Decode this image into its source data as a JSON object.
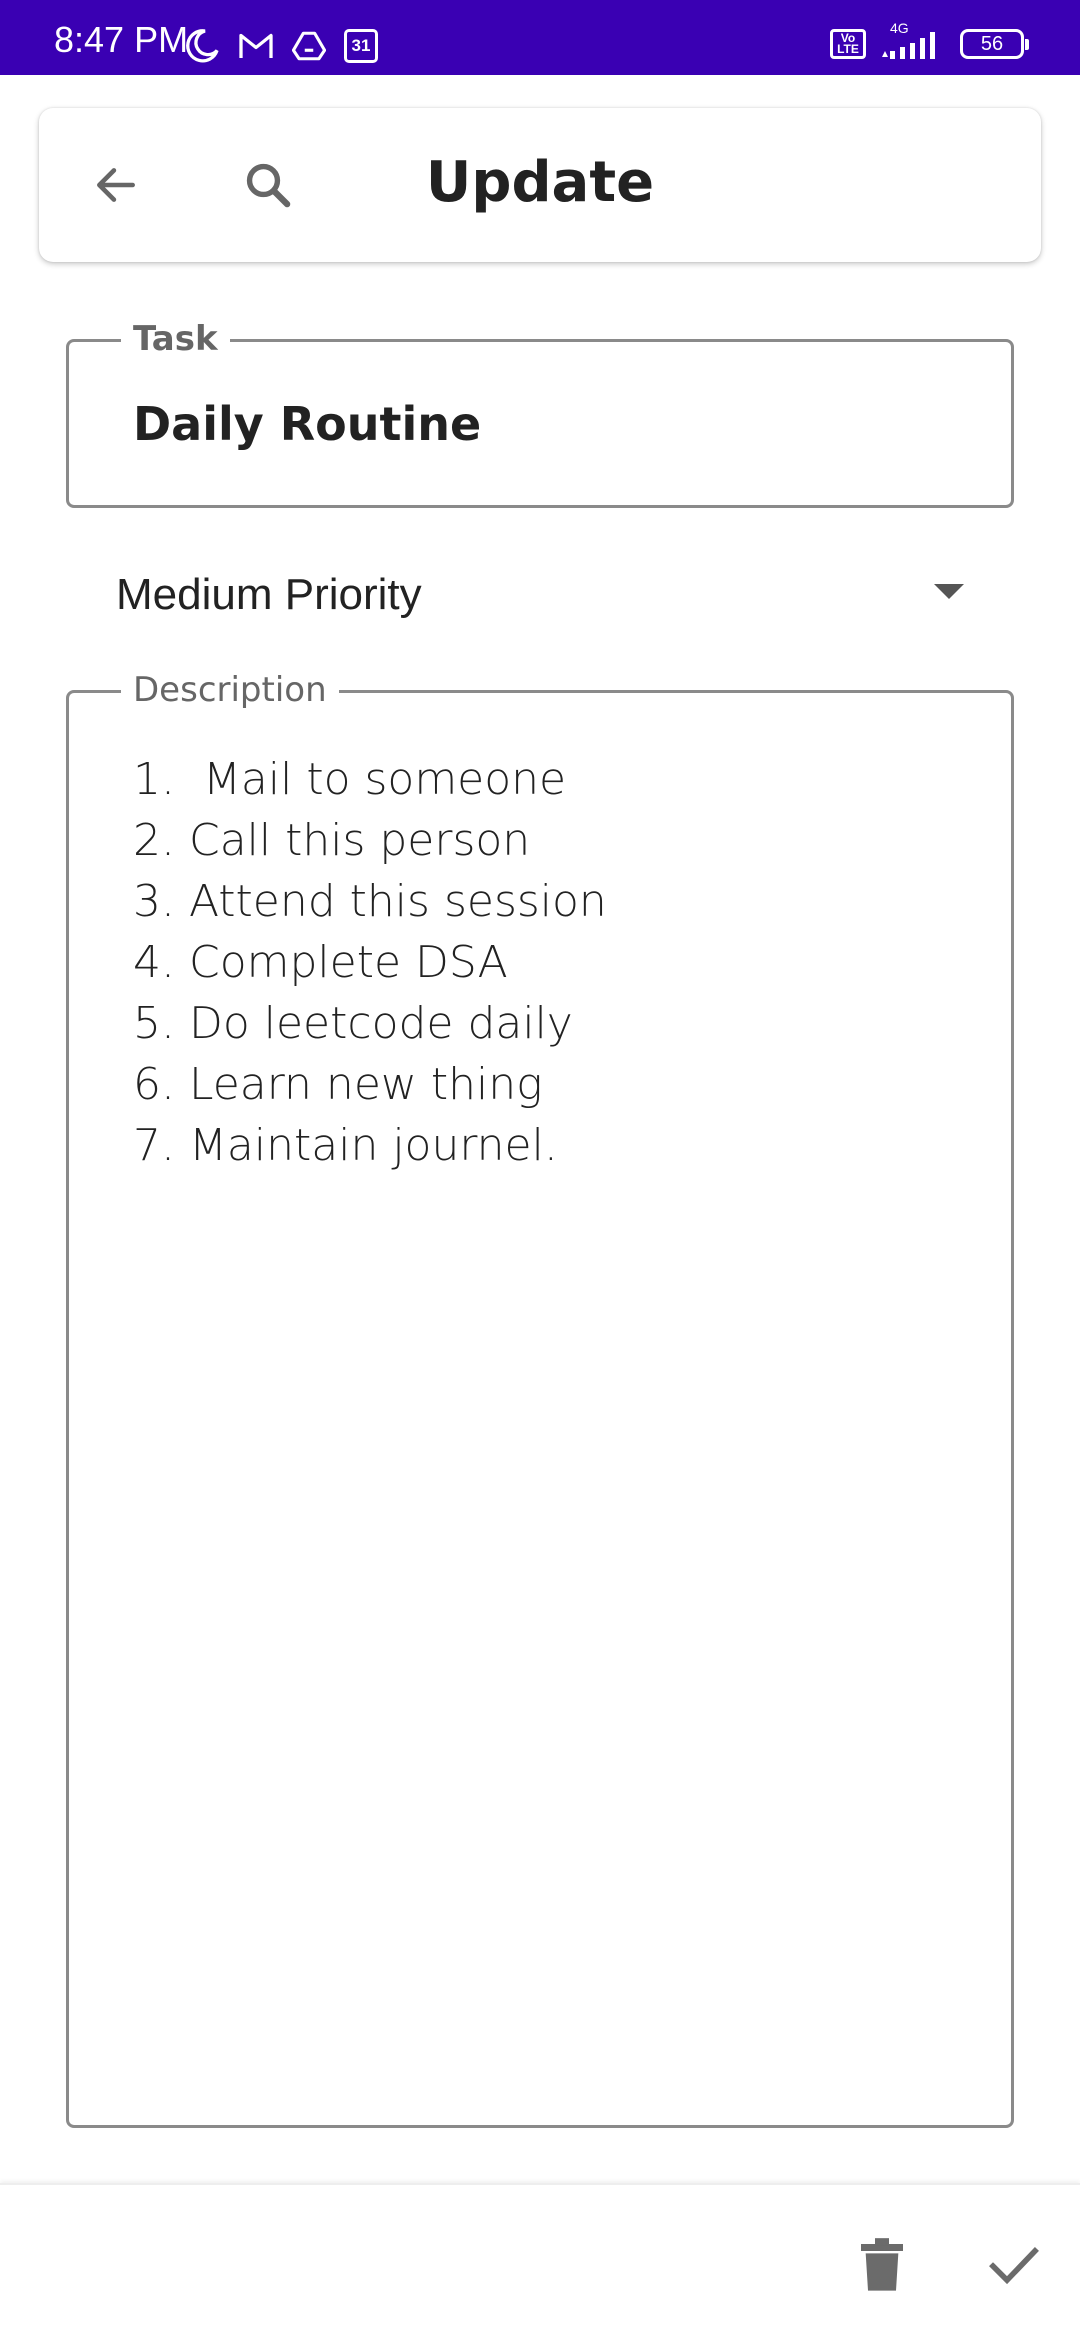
{
  "status_bar": {
    "time": "8:47 PM",
    "battery": "56",
    "network": "4G",
    "volte": "Vo LTE",
    "calendar_day": "31",
    "icons": [
      "moon-icon",
      "gmail-icon",
      "drive-icon",
      "calendar-icon",
      "volte-icon",
      "signal-icon",
      "battery-icon"
    ],
    "background_color": "#3a00b3"
  },
  "appbar": {
    "title": "Update",
    "back_icon": "arrow-left-icon",
    "search_icon": "search-icon"
  },
  "form": {
    "task": {
      "label": "Task",
      "value": "Daily Routine"
    },
    "priority": {
      "selected": "Medium Priority"
    },
    "description": {
      "label": "Description",
      "value": "1.  Mail to someone\n2. Call this person\n3. Attend this session\n4. Complete DSA\n5. Do leetcode daily\n6. Learn new thing\n7. Maintain journel."
    }
  },
  "bottom_bar": {
    "delete_icon": "trash-icon",
    "save_icon": "check-icon"
  }
}
